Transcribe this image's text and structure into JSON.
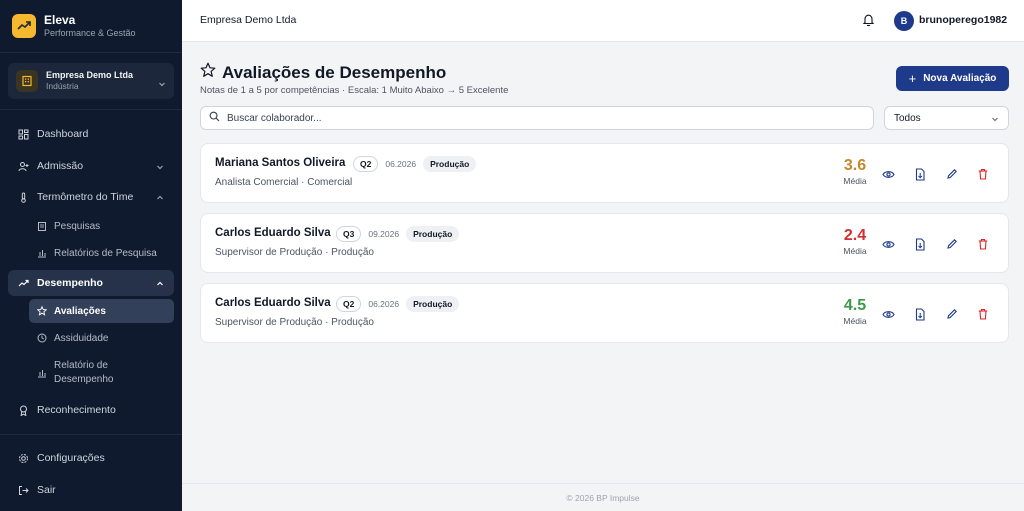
{
  "brand": {
    "name": "Eleva",
    "tagline": "Performance & Gestão"
  },
  "company_switcher": {
    "name": "Empresa Demo Ltda",
    "sector": "Indústria"
  },
  "sidebar": {
    "dashboard": "Dashboard",
    "admissao": "Admissão",
    "termometro": "Termômetro do Time",
    "pesquisas": "Pesquisas",
    "relatorios_pesquisa": "Relatórios de Pesquisa",
    "desempenho": "Desempenho",
    "avaliacoes": "Avaliações",
    "assiduidade": "Assiduidade",
    "relatorio_desempenho": "Relatório de Desempenho",
    "reconhecimento": "Reconhecimento",
    "configuracoes": "Configurações",
    "sair": "Sair"
  },
  "topbar": {
    "company": "Empresa Demo Ltda",
    "avatar_initial": "B",
    "username": "brunoperego1982"
  },
  "page": {
    "title": "Avaliações de Desempenho",
    "subtitle": "Notas de 1 a 5 por competências · Escala: 1 Muito Abaixo → 5 Excelente",
    "new_button": "Nova Avaliação",
    "search_placeholder": "Buscar colaborador...",
    "filter_value": "Todos"
  },
  "evaluations": [
    {
      "name": "Mariana Santos Oliveira",
      "quarter": "Q2",
      "period": "06.2026",
      "department": "Produção",
      "role_line": "Analista Comercial · Comercial",
      "score": "3.6",
      "score_label": "Média",
      "score_color": "#c28a2c"
    },
    {
      "name": "Carlos Eduardo Silva",
      "quarter": "Q3",
      "period": "09.2026",
      "department": "Produção",
      "role_line": "Supervisor de Produção · Produção",
      "score": "2.4",
      "score_label": "Média",
      "score_color": "#d12f2f"
    },
    {
      "name": "Carlos Eduardo Silva",
      "quarter": "Q2",
      "period": "06.2026",
      "department": "Produção",
      "role_line": "Supervisor de Produção · Produção",
      "score": "4.5",
      "score_label": "Média",
      "score_color": "#3a9a47"
    }
  ],
  "footer": {
    "text": "© 2026 BP Impulse"
  },
  "colors": {
    "sidebar_bg": "#0f1a2e",
    "primary": "#1e3a8a",
    "brand_accent": "#f5b82e",
    "danger": "#dc2626"
  },
  "icons": {
    "view": "eye-icon",
    "pdf": "file-icon",
    "edit": "pencil-icon",
    "delete": "trash-icon"
  }
}
